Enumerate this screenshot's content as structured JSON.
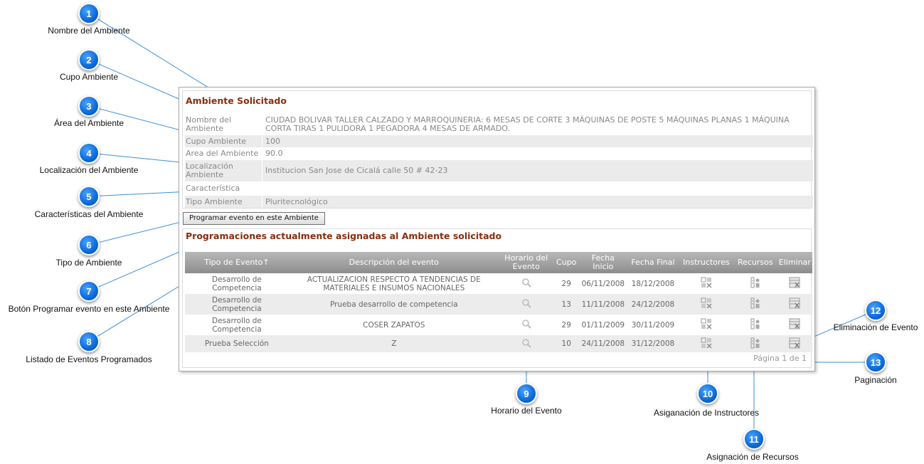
{
  "callouts": [
    {
      "num": "1",
      "label": "Nombre del Ambiente"
    },
    {
      "num": "2",
      "label": "Cupo Ambiente"
    },
    {
      "num": "3",
      "label": "Área del Ambiente"
    },
    {
      "num": "4",
      "label": "Localización del Ambiente"
    },
    {
      "num": "5",
      "label": "Características del Ambiente"
    },
    {
      "num": "6",
      "label": "Tipo de Ambiente"
    },
    {
      "num": "7",
      "label": "Botón Programar evento en este Ambiente"
    },
    {
      "num": "8",
      "label": "Listado de Eventos Programados"
    },
    {
      "num": "9",
      "label": "Horario del Evento"
    },
    {
      "num": "10",
      "label": "Asiganación de Instructores"
    },
    {
      "num": "11",
      "label": "Asignación de Recursos"
    },
    {
      "num": "12",
      "label": "Eliminación de Evento"
    },
    {
      "num": "13",
      "label": "Paginación"
    }
  ],
  "ambiente": {
    "title": "Ambiente Solicitado",
    "fields": [
      {
        "label": "Nombre del Ambiente",
        "value": "CIUDAD BOLIVAR TALLER CALZADO Y MARROQUINERIA: 6 MESAS DE CORTE 3 MÁQUINAS DE POSTE 5 MÁQUINAS PLANAS 1 MÁQUINA CORTA TIRAS 1 PULIDORA 1 PEGADORA 4 MESAS DE ARMADO."
      },
      {
        "label": "Cupo Ambiente",
        "value": "100"
      },
      {
        "label": "Area del Ambiente",
        "value": "90.0"
      },
      {
        "label": "Localización Ambiente",
        "value": "Institucion San Jose de Cicalá calle 50 # 42-23"
      },
      {
        "label": "Característica",
        "value": ""
      },
      {
        "label": "Tipo Ambiente",
        "value": "Pluritecnológico"
      }
    ],
    "button": "Programar evento en este Ambiente"
  },
  "programaciones": {
    "title": "Programaciones actualmente asignadas al Ambiente solicitado",
    "columns": [
      "Tipo de Evento↑",
      "Descripción del evento",
      "Horario del Evento",
      "Cupo",
      "Fecha Inicio",
      "Fecha Final",
      "Instructores",
      "Recursos",
      "Eliminar"
    ],
    "rows": [
      {
        "tipo": "Desarrollo de Competencia",
        "desc": "ACTUALIZACION RESPECTO A TENDENCIAS DE MATERIALES E INSUMOS NACIONALES",
        "cupo": "29",
        "inicio": "06/11/2008",
        "final": "18/12/2008"
      },
      {
        "tipo": "Desarrollo de Competencia",
        "desc": "Prueba desarrollo de competencia",
        "cupo": "13",
        "inicio": "11/11/2008",
        "final": "24/12/2008"
      },
      {
        "tipo": "Desarrollo de Competencia",
        "desc": "COSER ZAPATOS",
        "cupo": "29",
        "inicio": "01/11/2009",
        "final": "30/11/2009"
      },
      {
        "tipo": "Prueba Selección",
        "desc": "Z",
        "cupo": "10",
        "inicio": "24/11/2008",
        "final": "31/12/2008"
      }
    ],
    "pager": "Página 1 de 1"
  },
  "icons": {
    "horario": "magnifier-icon",
    "instructores": "instructors-icon",
    "recursos": "resources-icon",
    "eliminar": "delete-event-icon"
  },
  "colors": {
    "callout": "#0a6ad8",
    "section_title": "#8b2d0c",
    "header": "#9a9a9a",
    "line": "#3a8fd8"
  }
}
